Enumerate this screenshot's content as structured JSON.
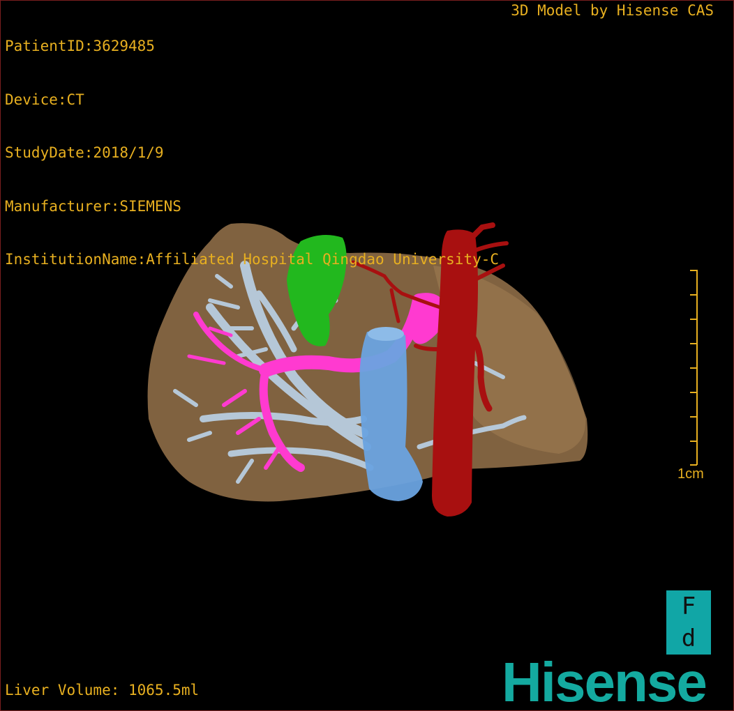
{
  "study_info": {
    "patient_id": "PatientID:3629485",
    "device": "Device:CT",
    "study_date": "StudyDate:2018/1/9",
    "manufacturer": "Manufacturer:SIEMENS",
    "institution": "InstitutionName:Affiliated Hospital Qingdao University-C"
  },
  "brand_caption": "3D Model by Hisense CAS",
  "liver_volume": "Liver Volume: 1065.5ml",
  "scale_bar": {
    "label": "1cm"
  },
  "orientation_cube": {
    "top_letter": "F",
    "bottom_letter": "d"
  },
  "logo_text": "Hisense",
  "colors": {
    "overlay_text": "#e8b020",
    "liver": "#8b6a45",
    "gallbladder": "#22b81e",
    "hepatic_veins": "#b8cde0",
    "portal_vein": "#ff3ad0",
    "ivc": "#6aa3e0",
    "aorta": "#a81010",
    "logo": "#14aaa0"
  }
}
